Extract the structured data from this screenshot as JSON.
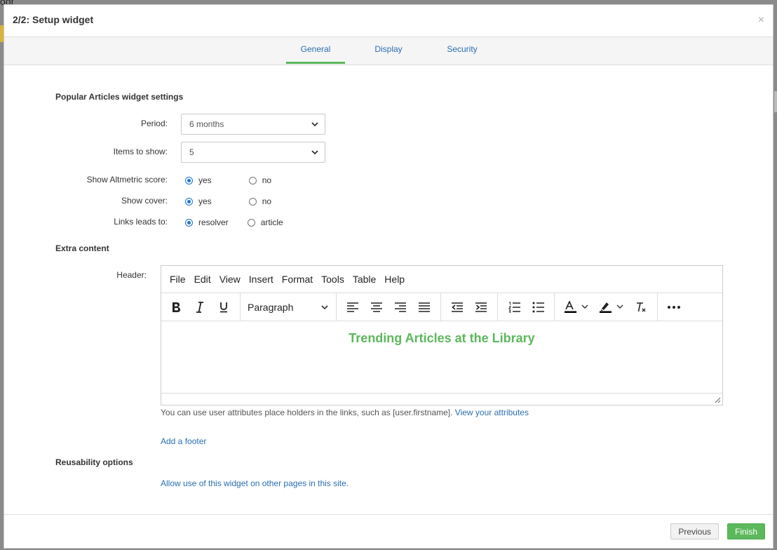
{
  "background": {
    "peek_text": "oot"
  },
  "modal": {
    "title": "2/2: Setup widget",
    "close_glyph": "×"
  },
  "tabs": [
    {
      "label": "General",
      "active": true
    },
    {
      "label": "Display",
      "active": false
    },
    {
      "label": "Security",
      "active": false
    }
  ],
  "settings": {
    "section_title": "Popular Articles widget settings",
    "period": {
      "label": "Period:",
      "value": "6 months"
    },
    "items": {
      "label": "Items to show:",
      "value": "5"
    },
    "altmetric": {
      "label": "Show Altmetric score:",
      "options": [
        "yes",
        "no"
      ],
      "selected": "yes"
    },
    "cover": {
      "label": "Show cover:",
      "options": [
        "yes",
        "no"
      ],
      "selected": "yes"
    },
    "links": {
      "label": "Links leads to:",
      "options": [
        "resolver",
        "article"
      ],
      "selected": "resolver"
    }
  },
  "extra": {
    "section_title": "Extra content",
    "header_label": "Header:",
    "menu": [
      "File",
      "Edit",
      "View",
      "Insert",
      "Format",
      "Tools",
      "Table",
      "Help"
    ],
    "block_format": "Paragraph",
    "content_heading": "Trending Articles at the Library",
    "help_text": "You can use user attributes place holders in the links, such as [user.firstname].",
    "help_link": "View your attributes",
    "add_footer": "Add a footer"
  },
  "reusability": {
    "section_title": "Reusability options",
    "link": "Allow use of this widget on other pages in this site."
  },
  "footer": {
    "previous": "Previous",
    "finish": "Finish"
  },
  "colors": {
    "accent": "#5cb85c",
    "link": "#2a6eb0",
    "radio": "#1976d2"
  }
}
